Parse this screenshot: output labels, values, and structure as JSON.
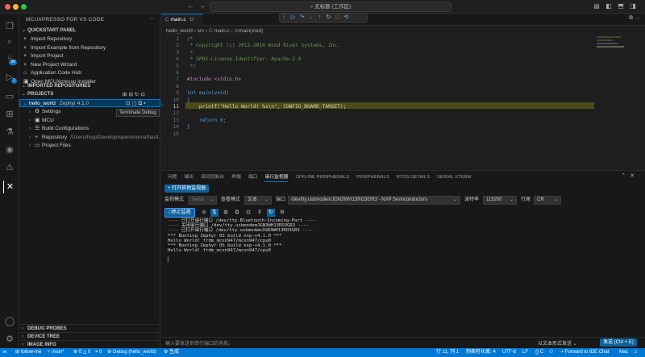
{
  "window": {
    "title": "无标题 (工作区)"
  },
  "sidebar": {
    "header": "MCUXPRESSO FOR VS CODE",
    "quickstart": {
      "title": "QUICKSTART PANEL",
      "items": [
        {
          "icon": "plus-icon",
          "label": "Import Repository"
        },
        {
          "icon": "plus-icon",
          "label": "Import Example from Repository"
        },
        {
          "icon": "plus-icon",
          "label": "Import Project"
        },
        {
          "icon": "plus-icon",
          "label": "New Project Wizard"
        },
        {
          "icon": "home-icon",
          "label": "Application Code Hub"
        },
        {
          "icon": "window-icon",
          "label": "Open MCUXpresso Installer"
        }
      ]
    },
    "imported_repos": {
      "title": "IMPORTED REPOSITORIES"
    },
    "projects": {
      "title": "PROJECTS",
      "project_name": "hello_world",
      "project_tag": "Zephyr 4.1.0",
      "tooltip": "Terminate Debug",
      "children": [
        {
          "label": "Settings",
          "detail": ""
        },
        {
          "label": "MCU",
          "detail": ""
        },
        {
          "label": "Build Configurations",
          "detail": ""
        },
        {
          "label": "Repository",
          "detail": "/Users/huqi/Develop/opensource/hard..."
        },
        {
          "label": "Project Files",
          "detail": ""
        }
      ]
    },
    "bottom_sections": [
      "DEBUG PROBES",
      "DEVICE TREE",
      "IMAGE INFO"
    ]
  },
  "editor": {
    "tab": {
      "label": "main.c",
      "status": "U"
    },
    "breadcrumb": [
      "hello_world",
      "src",
      "main.c",
      "main(void)"
    ],
    "lines": [
      {
        "n": "1",
        "text": "/*",
        "cls": "comment"
      },
      {
        "n": "2",
        "text": " * Copyright (c) 2012-2014 Wind River Systems, Inc.",
        "cls": "comment"
      },
      {
        "n": "3",
        "text": " *",
        "cls": "comment"
      },
      {
        "n": "4",
        "text": " * SPDX-License-Identifier: Apache-2.0",
        "cls": "comment"
      },
      {
        "n": "5",
        "text": " */",
        "cls": "comment"
      },
      {
        "n": "6",
        "text": "",
        "cls": ""
      },
      {
        "n": "7",
        "text": "#include <stdio.h>",
        "cls": "include"
      },
      {
        "n": "8",
        "text": "",
        "cls": ""
      },
      {
        "n": "9",
        "text": "int main(void)",
        "cls": "code"
      },
      {
        "n": "10",
        "text": "{",
        "cls": "code"
      },
      {
        "n": "11",
        "text": "    printf(\"Hello World! %s\\n\", CONFIG_BOARD_TARGET);",
        "cls": "printf"
      },
      {
        "n": "12",
        "text": "",
        "cls": ""
      },
      {
        "n": "13",
        "text": "    return 0;",
        "cls": "code"
      },
      {
        "n": "14",
        "text": "}",
        "cls": "code"
      },
      {
        "n": "15",
        "text": "",
        "cls": ""
      }
    ]
  },
  "panel": {
    "tabs": [
      "问题",
      "输出",
      "调试控制台",
      "终端",
      "端口",
      "串行监视器",
      "OFFLINE PERIPHERALS",
      "PERIPHERALS",
      "RTOS DETAILS",
      "SERIAL XTERM"
    ],
    "active_tab": "串行监视器",
    "open_other_monitor": "+ 打开其他监视器",
    "monitor_mode_label": "监视模式",
    "monitor_mode_value": "Serial",
    "view_mode_label": "查看模式",
    "view_mode_value": "文本",
    "port_label": "端口",
    "port_value": "/dev/tty.usbmodemJGN3WH13RO3GR3 - NXP Semiconductors",
    "baud_label": "波特率",
    "baud_value": "115200",
    "line_ending_label": "行尾",
    "line_ending_value": "CR",
    "stop_button": "停止监视",
    "terminal_lines": [
      "---- 已打开串行端口 /dev/tty.Bluetooth-Incoming-Port ----",
      "---- 关闭串行端口 /dev/tty.usbmodemJGN3WH13RO3GR3 ----",
      "---- 已打开串行端口 /dev/tty.usbmodemJGN3WH13RO3GR3 ----",
      "*** Booting Zephyr OS build nxp-v4.1.0 ***",
      "Hello World! frdm_mcxn947/mcxn947/cpu0",
      "*** Booting Zephyr OS build nxp-v4.1.0 ***",
      "Hello World! frdm_mcxn947/mcxn947/cpu0"
    ],
    "send_placeholder": "输入要发送到串行端口的消息。",
    "send_as_text": "以文本形式发送",
    "send_button": "发送 (Ctrl + E)"
  },
  "statusbar": {
    "branch": "follow-me",
    "git": "main*",
    "errors": "0",
    "warnings": "0",
    "ports": "0",
    "debug": "Debug (hello_world)",
    "build": "生成",
    "cursor": "行 11, 列 1",
    "tabsize": "制表符长度: 4",
    "encoding": "UTF-8",
    "eol": "LF",
    "language": "C",
    "forward": "Forward to IDE Chat",
    "platform": "Mac"
  },
  "colors": {
    "accent": "#0078d4",
    "comment": "#6a9955",
    "keyword": "#569cd6",
    "string": "#ce9178",
    "function": "#dcdcaa",
    "macro": "#4fc1ff",
    "include": "#c586c0"
  }
}
